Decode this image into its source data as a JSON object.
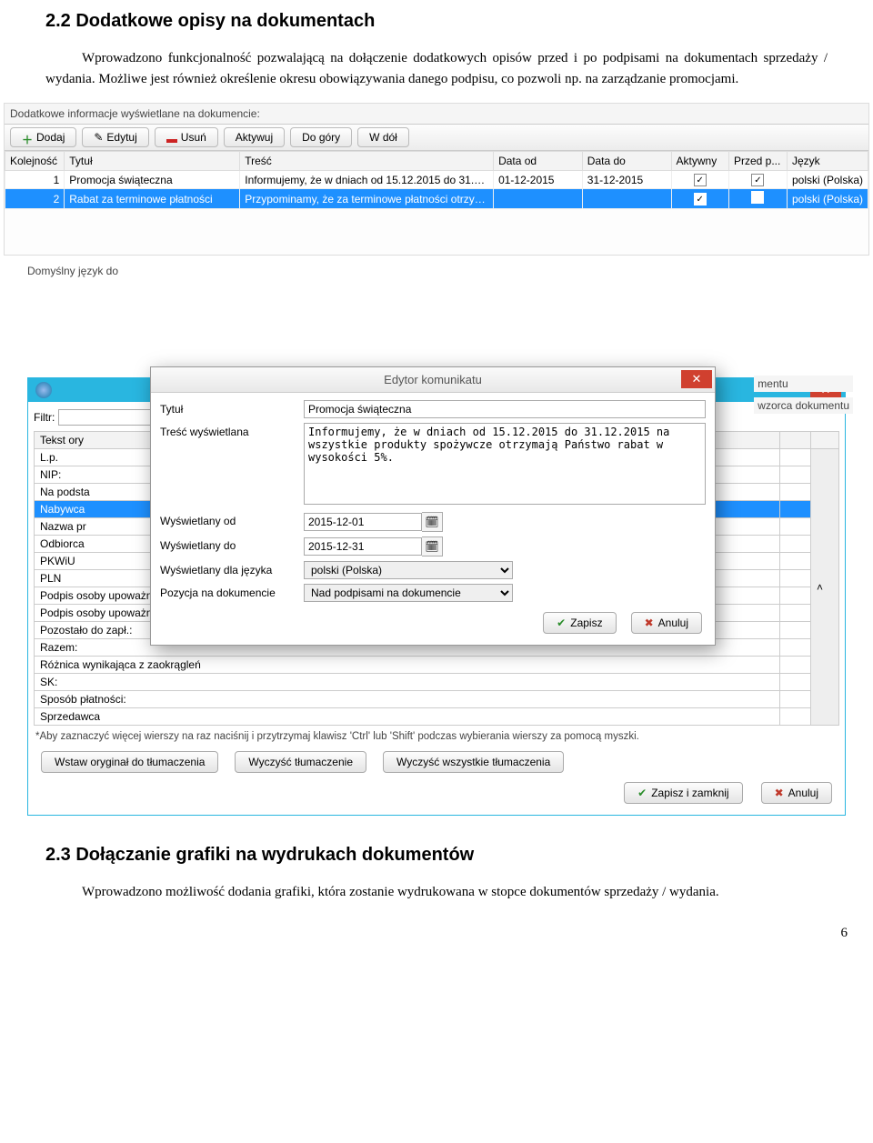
{
  "sections": {
    "h22": "2.2 Dodatkowe opisy na dokumentach",
    "p22": "Wprowadzono funkcjonalność pozwalającą na dołączenie dodatkowych opisów przed i po podpisami na dokumentach sprzedaży / wydania. Możliwe jest również określenie okresu obowiązywania danego podpisu, co pozwoli np. na zarządzanie promocjami.",
    "h23": "2.3  Dołączanie grafiki na wydrukach dokumentów",
    "p23": "Wprowadzono możliwość dodania grafiki, która zostanie wydrukowana w stopce dokumentów sprzedaży / wydania.",
    "page_num": "6"
  },
  "scr1": {
    "label": "Dodatkowe informacje wyświetlane na dokumencie:",
    "toolbar": {
      "add": "Dodaj",
      "edit": "Edytuj",
      "del": "Usuń",
      "activate": "Aktywuj",
      "up": "Do góry",
      "down": "W dół"
    },
    "cols": {
      "no": "Kolejność",
      "title": "Tytuł",
      "content": "Treść",
      "from": "Data od",
      "to": "Data do",
      "active": "Aktywny",
      "before": "Przed p...",
      "lang": "Język"
    },
    "rows": [
      {
        "no": "1",
        "title": "Promocja świąteczna",
        "content": "Informujemy, że w dniach od 15.12.2015 do 31.12.2015 n...",
        "from": "01-12-2015",
        "to": "31-12-2015",
        "active": true,
        "before": true,
        "lang": "polski (Polska)",
        "sel": false
      },
      {
        "no": "2",
        "title": "Rabat za terminowe płatności",
        "content": "Przypominamy, że za terminowe płatności otrzymają Państ...",
        "from": "",
        "to": "",
        "active": true,
        "before": false,
        "lang": "polski (Polska)",
        "sel": true
      }
    ]
  },
  "lang_partial": "Domyślny język do",
  "bg_right1": "mentu",
  "bg_right2": "wzorca dokumentu",
  "modal": {
    "title": "Edytor komunikatu",
    "fields": {
      "tytul_l": "Tytuł",
      "tytul_v": "Promocja świąteczna",
      "tresc_l": "Treść wyświetlana",
      "tresc_v": "Informujemy, że w dniach od 15.12.2015 do 31.12.2015 na wszystkie produkty spożywcze otrzymają Państwo rabat w wysokości 5%.",
      "od_l": "Wyświetlany od",
      "od_v": "2015-12-01",
      "do_l": "Wyświetlany do",
      "do_v": "2015-12-31",
      "lang_l": "Wyświetlany dla języka",
      "lang_v": "polski (Polska)",
      "pos_l": "Pozycja na dokumencie",
      "pos_v": "Nad podpisami na dokumencie"
    },
    "save": "Zapisz",
    "cancel": "Anuluj"
  },
  "under": {
    "filtr_l": "Filtr:",
    "col1": "Tekst ory",
    "items": [
      "L.p.",
      "NIP:",
      "Na podsta",
      "Nabywca",
      "Nazwa pr",
      "Odbiorca",
      "PKWiU",
      "PLN",
      "Podpis osoby upoważnionej do odbioru dokumentu",
      "Podpis osoby upoważnionej do wystawienia dokumentu",
      "Pozostało do zapł.:",
      "Razem:",
      "Różnica wynikająca z zaokrągleń",
      "SK:",
      "Sposób płatności:",
      "Sprzedawca"
    ],
    "sel_index": 3,
    "hint": "*Aby zaznaczyć więcej wierszy na raz naciśnij i przytrzymaj klawisz 'Ctrl' lub 'Shift' podczas wybierania wierszy za pomocą myszki.",
    "b1": "Wstaw oryginał do tłumaczenia",
    "b2": "Wyczyść tłumaczenie",
    "b3": "Wyczyść wszystkie tłumaczenia",
    "save": "Zapisz i zamknij",
    "cancel": "Anuluj"
  }
}
